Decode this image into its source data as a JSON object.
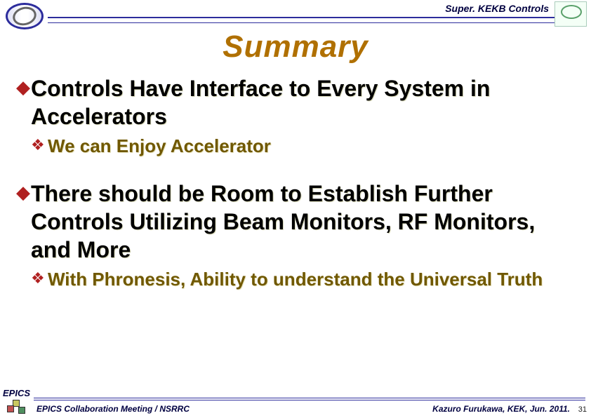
{
  "header": {
    "label": "Super. KEKB Controls"
  },
  "title": "Summary",
  "bullets": {
    "b1": "Controls Have Interface to Every System in Accelerators",
    "b1a": "We can Enjoy Accelerator",
    "b2": "There should be Room to Establish Further Controls Utilizing Beam Monitors, RF Monitors, and More",
    "b2a": "With Phronesis, Ability to understand the Universal Truth"
  },
  "footer": {
    "epics": "EPICS",
    "left": "EPICS Collaboration Meeting / NSRRC",
    "right": "Kazuro Furukawa, KEK, Jun. 2011.",
    "page": "31"
  }
}
